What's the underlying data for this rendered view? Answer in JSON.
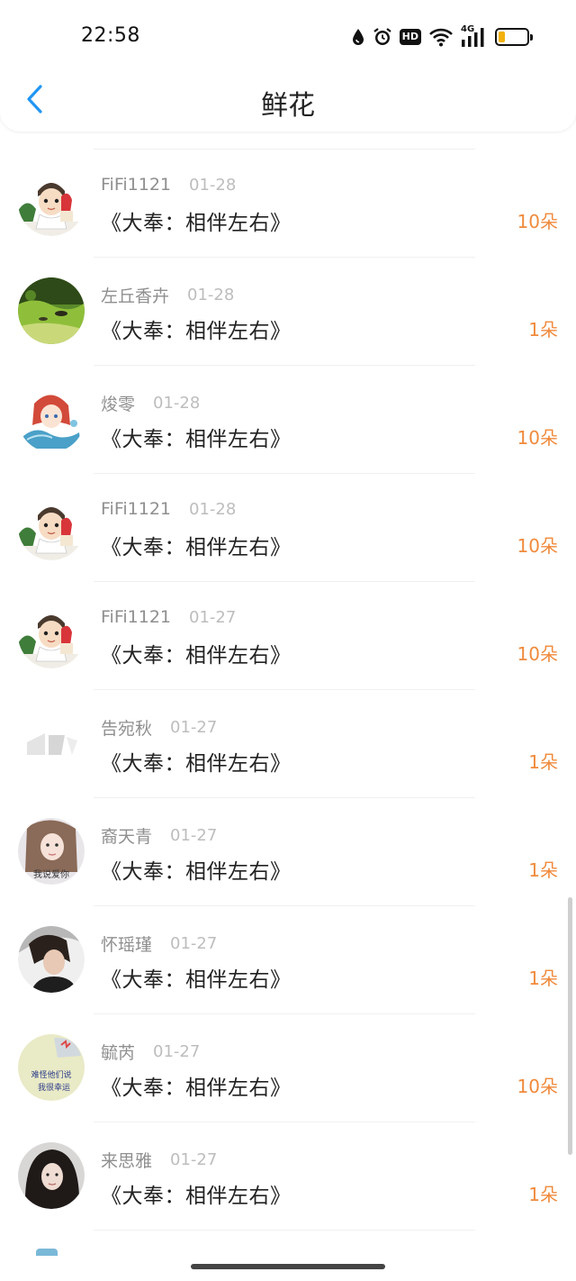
{
  "status_bar": {
    "time": "22:58",
    "icons": [
      "drop-icon",
      "alarm-icon",
      "hd-icon",
      "wifi-icon",
      "4g-signal-icon",
      "battery-icon"
    ],
    "hd_label": "HD",
    "network_label": "4G",
    "battery_level": 0.22,
    "battery_color": "#f2b10d"
  },
  "nav": {
    "back_icon": "chevron-left-icon",
    "title": "鲜花"
  },
  "colors": {
    "accent": "#2196f3",
    "amount": "#f08a3c",
    "username": "#8f8f8f",
    "date": "#bdbdbd"
  },
  "records": [
    {
      "user": "FiFi1121",
      "date": "01-28",
      "book": "《大奉：相伴左右》",
      "amount": "10朵",
      "avatar": "cartoon-boy-avatar"
    },
    {
      "user": "左丘香卉",
      "date": "01-28",
      "book": "《大奉：相伴左右》",
      "amount": "1朵",
      "avatar": "aquarium-fish-avatar"
    },
    {
      "user": "焌零",
      "date": "01-28",
      "book": "《大奉：相伴左右》",
      "amount": "10朵",
      "avatar": "anime-girl-avatar"
    },
    {
      "user": "FiFi1121",
      "date": "01-28",
      "book": "《大奉：相伴左右》",
      "amount": "10朵",
      "avatar": "cartoon-boy-avatar"
    },
    {
      "user": "FiFi1121",
      "date": "01-27",
      "book": "《大奉：相伴左右》",
      "amount": "10朵",
      "avatar": "cartoon-boy-avatar"
    },
    {
      "user": "告宛秋",
      "date": "01-27",
      "book": "《大奉：相伴左右》",
      "amount": "1朵",
      "avatar": "faded-logo-avatar"
    },
    {
      "user": "裔天青",
      "date": "01-27",
      "book": "《大奉：相伴左右》",
      "amount": "1朵",
      "avatar": "girl-photo-avatar",
      "avatar_text": "我说爱你"
    },
    {
      "user": "怀瑶瑾",
      "date": "01-27",
      "book": "《大奉：相伴左右》",
      "amount": "1朵",
      "avatar": "boy-photo-avatar"
    },
    {
      "user": "毓芮",
      "date": "01-27",
      "book": "《大奉：相伴左右》",
      "amount": "10朵",
      "avatar": "text-graphic-avatar",
      "avatar_text_1": "难怪他们说",
      "avatar_text_2": "我很幸运"
    },
    {
      "user": "来思雅",
      "date": "01-27",
      "book": "《大奉：相伴左右》",
      "amount": "1朵",
      "avatar": "girl-portrait-avatar"
    }
  ]
}
